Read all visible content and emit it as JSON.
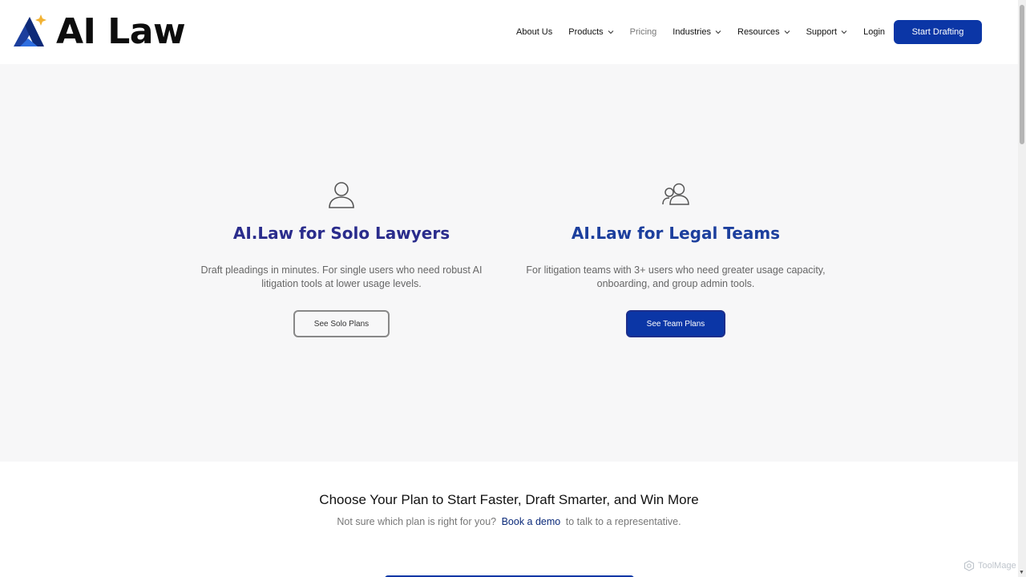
{
  "header": {
    "logo_text": "AI Law",
    "nav": [
      {
        "label": "About Us",
        "dropdown": false
      },
      {
        "label": "Products",
        "dropdown": true
      },
      {
        "label": "Pricing",
        "dropdown": false
      },
      {
        "label": "Industries",
        "dropdown": true
      },
      {
        "label": "Resources",
        "dropdown": true
      },
      {
        "label": "Support",
        "dropdown": true
      },
      {
        "label": "Login",
        "dropdown": false
      }
    ],
    "cta_label": "Start Drafting"
  },
  "hero": {
    "solo": {
      "icon": "user-icon",
      "title": "AI.Law for Solo Lawyers",
      "description": "Draft pleadings in minutes.  For single users who need robust AI litigation tools at lower usage levels.",
      "button_label": "See Solo Plans"
    },
    "team": {
      "icon": "users-icon",
      "title": "AI.Law for Legal Teams",
      "description": "For litigation teams with 3+ users who need greater usage capacity, onboarding, and group admin tools.",
      "button_label": "See Team Plans"
    }
  },
  "plans": {
    "heading": "Choose Your Plan to Start Faster, Draft Smarter, and Win More",
    "sub_before": "Not sure which plan is right for you?",
    "sub_link": "Book a demo",
    "sub_after": "to talk to a representative."
  },
  "watermark": "ToolMage",
  "colors": {
    "brand_blue": "#0b36a6",
    "title_indigo": "#2a2c8c",
    "hero_bg": "#f7f7f8",
    "logo_accent": "#f2b233"
  }
}
